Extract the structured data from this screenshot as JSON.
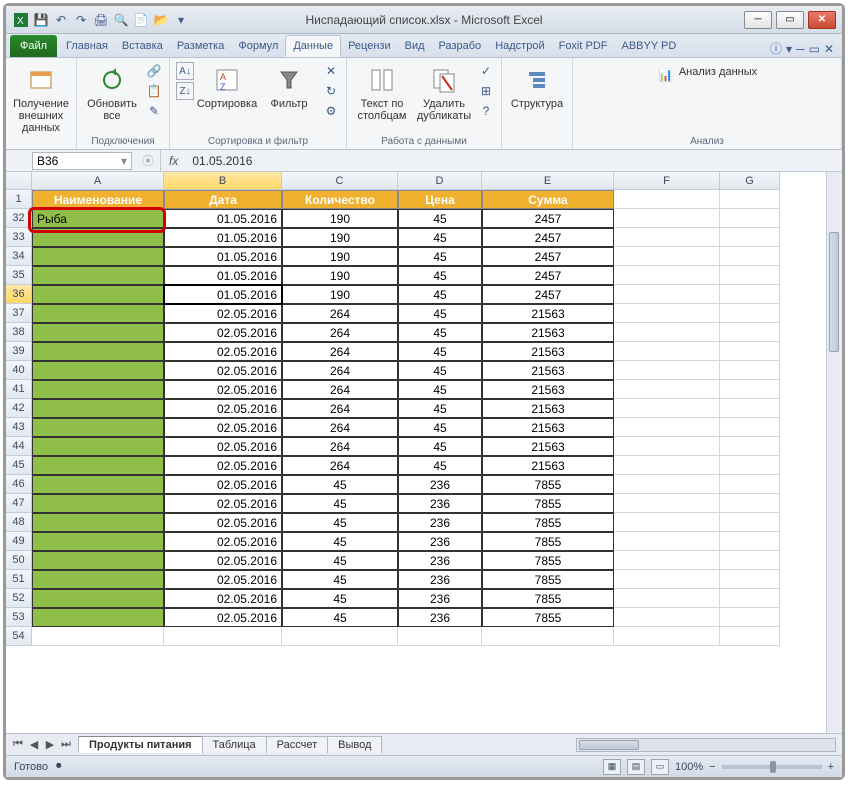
{
  "window": {
    "title": "Ниспадающий список.xlsx - Microsoft Excel"
  },
  "qat": [
    "excel",
    "save",
    "undo",
    "redo",
    "print",
    "preview",
    "new",
    "open"
  ],
  "tabs": {
    "file": "Файл",
    "items": [
      "Главная",
      "Вставка",
      "Разметка",
      "Формул",
      "Данные",
      "Рецензи",
      "Вид",
      "Разрабо",
      "Надстрой",
      "Foxit PDF",
      "ABBYY PD"
    ],
    "active_index": 4
  },
  "ribbon": {
    "groups": [
      {
        "label": "",
        "big": [
          {
            "label": "Получение\nвнешних данных",
            "icon": "import"
          }
        ]
      },
      {
        "label": "Подключения",
        "big": [
          {
            "label": "Обновить\nвсе",
            "icon": "refresh"
          }
        ],
        "small": [
          "conn",
          "props",
          "links"
        ]
      },
      {
        "label": "Сортировка и фильтр",
        "big": [
          {
            "label": "Сортировка",
            "icon": "sort"
          },
          {
            "label": "Фильтр",
            "icon": "filter"
          }
        ],
        "sort_az": "az",
        "small": [
          "clear",
          "reapply",
          "adv"
        ]
      },
      {
        "label": "Работа с данными",
        "big": [
          {
            "label": "Текст по\nстолбцам",
            "icon": "t2c"
          },
          {
            "label": "Удалить\nдубликаты",
            "icon": "dup"
          }
        ],
        "small": [
          "valid",
          "consol",
          "whatif"
        ]
      },
      {
        "label": "",
        "big": [
          {
            "label": "Структура",
            "icon": "outline"
          }
        ]
      },
      {
        "label": "Анализ",
        "item": "Анализ данных"
      }
    ]
  },
  "formula_bar": {
    "name_box": "B36",
    "formula": "01.05.2016"
  },
  "columns": [
    "A",
    "B",
    "C",
    "D",
    "E",
    "F",
    "G"
  ],
  "selected_col_index": 1,
  "selected_row": 36,
  "header_row_label": "1",
  "headers": [
    "Наименование",
    "Дата",
    "Количество",
    "Цена",
    "Сумма"
  ],
  "row_numbers": [
    32,
    33,
    34,
    35,
    36,
    37,
    38,
    39,
    40,
    41,
    42,
    43,
    44,
    45,
    46,
    47,
    48,
    49,
    50,
    51,
    52,
    53,
    54
  ],
  "rows": [
    {
      "n": 32,
      "a": "Рыба",
      "b": "01.05.2016",
      "c": "190",
      "d": "45",
      "e": "2457"
    },
    {
      "n": 33,
      "a": "",
      "b": "01.05.2016",
      "c": "190",
      "d": "45",
      "e": "2457"
    },
    {
      "n": 34,
      "a": "",
      "b": "01.05.2016",
      "c": "190",
      "d": "45",
      "e": "2457"
    },
    {
      "n": 35,
      "a": "",
      "b": "01.05.2016",
      "c": "190",
      "d": "45",
      "e": "2457"
    },
    {
      "n": 36,
      "a": "",
      "b": "01.05.2016",
      "c": "190",
      "d": "45",
      "e": "2457"
    },
    {
      "n": 37,
      "a": "",
      "b": "02.05.2016",
      "c": "264",
      "d": "45",
      "e": "21563"
    },
    {
      "n": 38,
      "a": "",
      "b": "02.05.2016",
      "c": "264",
      "d": "45",
      "e": "21563"
    },
    {
      "n": 39,
      "a": "",
      "b": "02.05.2016",
      "c": "264",
      "d": "45",
      "e": "21563"
    },
    {
      "n": 40,
      "a": "",
      "b": "02.05.2016",
      "c": "264",
      "d": "45",
      "e": "21563"
    },
    {
      "n": 41,
      "a": "",
      "b": "02.05.2016",
      "c": "264",
      "d": "45",
      "e": "21563"
    },
    {
      "n": 42,
      "a": "",
      "b": "02.05.2016",
      "c": "264",
      "d": "45",
      "e": "21563"
    },
    {
      "n": 43,
      "a": "",
      "b": "02.05.2016",
      "c": "264",
      "d": "45",
      "e": "21563"
    },
    {
      "n": 44,
      "a": "",
      "b": "02.05.2016",
      "c": "264",
      "d": "45",
      "e": "21563"
    },
    {
      "n": 45,
      "a": "",
      "b": "02.05.2016",
      "c": "264",
      "d": "45",
      "e": "21563"
    },
    {
      "n": 46,
      "a": "",
      "b": "02.05.2016",
      "c": "45",
      "d": "236",
      "e": "7855"
    },
    {
      "n": 47,
      "a": "",
      "b": "02.05.2016",
      "c": "45",
      "d": "236",
      "e": "7855"
    },
    {
      "n": 48,
      "a": "",
      "b": "02.05.2016",
      "c": "45",
      "d": "236",
      "e": "7855"
    },
    {
      "n": 49,
      "a": "",
      "b": "02.05.2016",
      "c": "45",
      "d": "236",
      "e": "7855"
    },
    {
      "n": 50,
      "a": "",
      "b": "02.05.2016",
      "c": "45",
      "d": "236",
      "e": "7855"
    },
    {
      "n": 51,
      "a": "",
      "b": "02.05.2016",
      "c": "45",
      "d": "236",
      "e": "7855"
    },
    {
      "n": 52,
      "a": "",
      "b": "02.05.2016",
      "c": "45",
      "d": "236",
      "e": "7855"
    },
    {
      "n": 53,
      "a": "",
      "b": "02.05.2016",
      "c": "45",
      "d": "236",
      "e": "7855"
    }
  ],
  "sheets": {
    "items": [
      "Продукты питания",
      "Таблица",
      "Рассчет",
      "Вывод"
    ],
    "active_index": 0
  },
  "status": {
    "ready": "Готово",
    "zoom": "100%"
  }
}
